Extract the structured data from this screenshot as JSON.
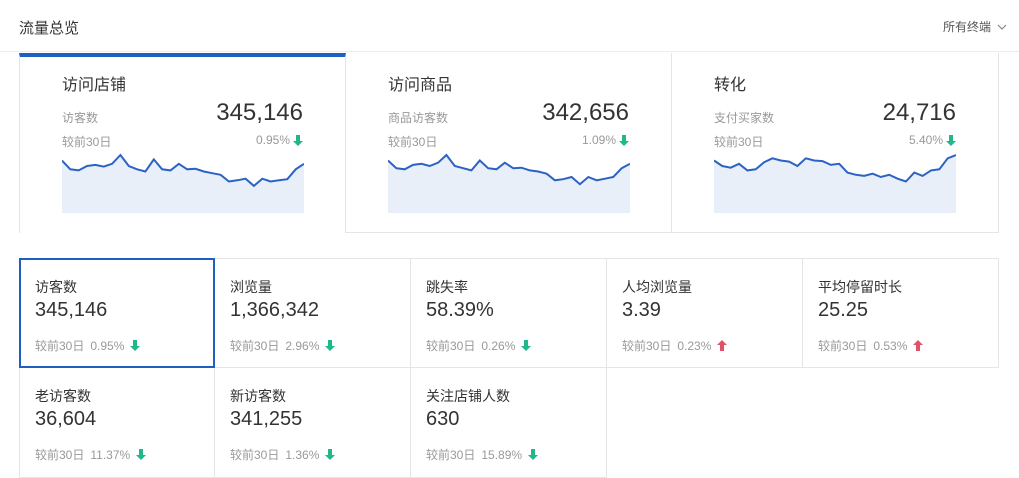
{
  "header": {
    "title": "流量总览",
    "terminal_select": "所有终端"
  },
  "colors": {
    "accent": "#1f5fbf",
    "down": "#1fb88a",
    "up": "#e0526a",
    "spark_line": "#2b62c4",
    "spark_fill": "#e8eff9"
  },
  "cards": [
    {
      "title": "访问店铺",
      "metric_label": "访客数",
      "value": "345,146",
      "compare_label": "较前30日",
      "delta": "0.95%",
      "direction": "down",
      "active": true,
      "trend": [
        0.88,
        0.72,
        0.7,
        0.78,
        0.8,
        0.77,
        0.82,
        0.98,
        0.78,
        0.72,
        0.68,
        0.9,
        0.72,
        0.7,
        0.82,
        0.72,
        0.73,
        0.68,
        0.65,
        0.62,
        0.5,
        0.52,
        0.55,
        0.42,
        0.55,
        0.5,
        0.52,
        0.54,
        0.72,
        0.82
      ]
    },
    {
      "title": "访问商品",
      "metric_label": "商品访客数",
      "value": "342,656",
      "compare_label": "较前30日",
      "delta": "1.09%",
      "direction": "down",
      "active": false,
      "trend": [
        0.88,
        0.74,
        0.72,
        0.8,
        0.82,
        0.78,
        0.84,
        0.98,
        0.78,
        0.74,
        0.7,
        0.88,
        0.74,
        0.72,
        0.84,
        0.74,
        0.75,
        0.7,
        0.68,
        0.64,
        0.52,
        0.54,
        0.58,
        0.45,
        0.58,
        0.52,
        0.55,
        0.58,
        0.74,
        0.82
      ]
    },
    {
      "title": "转化",
      "metric_label": "支付买家数",
      "value": "24,716",
      "compare_label": "较前30日",
      "delta": "5.40%",
      "direction": "down",
      "active": false,
      "trend": [
        0.88,
        0.78,
        0.75,
        0.82,
        0.7,
        0.72,
        0.85,
        0.92,
        0.88,
        0.86,
        0.78,
        0.92,
        0.88,
        0.87,
        0.8,
        0.82,
        0.66,
        0.62,
        0.6,
        0.64,
        0.58,
        0.62,
        0.55,
        0.5,
        0.66,
        0.6,
        0.7,
        0.72,
        0.92,
        0.98
      ]
    }
  ],
  "metrics": [
    {
      "label": "访客数",
      "value": "345,146",
      "compare_label": "较前30日",
      "delta": "0.95%",
      "direction": "down",
      "selected": true
    },
    {
      "label": "浏览量",
      "value": "1,366,342",
      "compare_label": "较前30日",
      "delta": "2.96%",
      "direction": "down",
      "selected": false
    },
    {
      "label": "跳失率",
      "value": "58.39%",
      "compare_label": "较前30日",
      "delta": "0.26%",
      "direction": "down",
      "selected": false
    },
    {
      "label": "人均浏览量",
      "value": "3.39",
      "compare_label": "较前30日",
      "delta": "0.23%",
      "direction": "up",
      "selected": false
    },
    {
      "label": "平均停留时长",
      "value": "25.25",
      "compare_label": "较前30日",
      "delta": "0.53%",
      "direction": "up",
      "selected": false
    },
    {
      "label": "老访客数",
      "value": "36,604",
      "compare_label": "较前30日",
      "delta": "11.37%",
      "direction": "down",
      "selected": false
    },
    {
      "label": "新访客数",
      "value": "341,255",
      "compare_label": "较前30日",
      "delta": "1.36%",
      "direction": "down",
      "selected": false
    },
    {
      "label": "关注店铺人数",
      "value": "630",
      "compare_label": "较前30日",
      "delta": "15.89%",
      "direction": "down",
      "selected": false
    }
  ]
}
